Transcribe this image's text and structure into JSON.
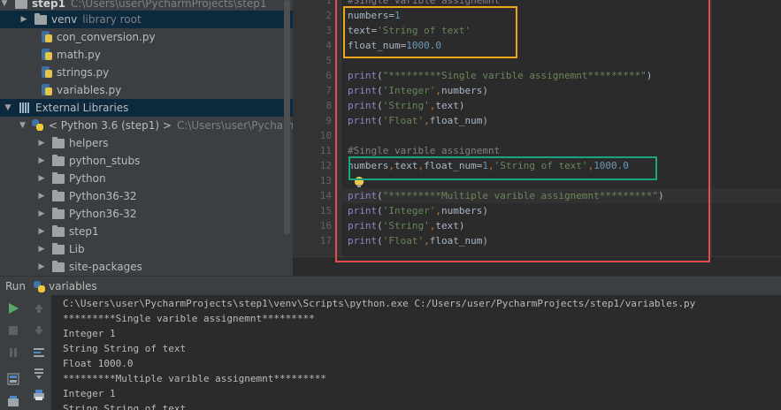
{
  "project_tree": {
    "rows": [
      {
        "label": "step1",
        "muted": "C:\\Users\\user\\PycharmProjects\\step1"
      },
      {
        "label": "venv",
        "muted": "library root"
      },
      {
        "label": "con_conversion.py"
      },
      {
        "label": "math.py"
      },
      {
        "label": "strings.py"
      },
      {
        "label": "variables.py"
      },
      {
        "label": "External Libraries"
      },
      {
        "label": "< Python 3.6 (step1) >",
        "muted": "C:\\Users\\user\\PycharmProjects"
      },
      {
        "label": "helpers"
      },
      {
        "label": "python_stubs"
      },
      {
        "label": "Python"
      },
      {
        "label": "Python36-32"
      },
      {
        "label": "Python36-32"
      },
      {
        "label": "step1"
      },
      {
        "label": "Lib"
      },
      {
        "label": "site-packages"
      }
    ]
  },
  "editor": {
    "line_numbers": [
      "1",
      "2",
      "3",
      "4",
      "5",
      "6",
      "7",
      "8",
      "9",
      "10",
      "11",
      "12",
      "13",
      "14",
      "15",
      "16",
      "17"
    ],
    "lines": {
      "l1": "#Single varible assignemnt",
      "l2_var": "numbers",
      "l2_op": "=",
      "l2_val": "1",
      "l3_var": "text",
      "l3_op": "=",
      "l3_val": "'String of text'",
      "l4_var": "float_num",
      "l4_op": "=",
      "l4_val": "1000.0",
      "l6_fn": "print",
      "l6_rest_open": "(",
      "l6_str": "\"*********Single varible assignemnt*********\"",
      "l6_close": ")",
      "l7_fn": "print",
      "l7_open": "(",
      "l7_str": "'Integer'",
      "l7_comma": ",",
      "l7_arg": "numbers",
      "l7_close": ")",
      "l8_fn": "print",
      "l8_open": "(",
      "l8_str": "'String'",
      "l8_comma": ",",
      "l8_arg": "text",
      "l8_close": ")",
      "l9_fn": "print",
      "l9_open": "(",
      "l9_str": "'Float'",
      "l9_comma": ",",
      "l9_arg": "float_num",
      "l9_close": ")",
      "l11": "#Single varible assignemnt",
      "l12_a": "numbers",
      "l12_c1": ",",
      "l12_b": "text",
      "l12_c2": ",",
      "l12_c": "float_num",
      "l12_eq": "=",
      "l12_v1": "1",
      "l12_c3": ",",
      "l12_v2": "'String of text'",
      "l12_c4": ",",
      "l12_v3": "1000.0",
      "l14_fn": "print",
      "l14_open": "(",
      "l14_str": "\"*********Multiple varible assignemnt*********\"",
      "l14_close": ")",
      "l15_fn": "print",
      "l15_open": "(",
      "l15_str": "'Integer'",
      "l15_comma": ",",
      "l15_arg": "numbers",
      "l15_close": ")",
      "l16_fn": "print",
      "l16_open": "(",
      "l16_str": "'String'",
      "l16_comma": ",",
      "l16_arg": "text",
      "l16_close": ")",
      "l17_fn": "print",
      "l17_open": "(",
      "l17_str": "'Float'",
      "l17_comma": ",",
      "l17_arg": "float_num",
      "l17_close": ")"
    }
  },
  "run_panel": {
    "label": "Run",
    "tab": "variables",
    "output": [
      "C:\\Users\\user\\PycharmProjects\\step1\\venv\\Scripts\\python.exe C:/Users/user/PycharmProjects/step1/variables.py",
      "*********Single varible assignemnt*********",
      "Integer 1",
      "String String of text",
      "Float 1000.0",
      "*********Multiple varible assignemnt*********",
      "Integer 1",
      "String String of text"
    ]
  },
  "colors": {
    "annotation_red": "#e54d4d",
    "annotation_orange": "#f2a51b",
    "annotation_teal": "#19a57f",
    "run_green": "#59a869"
  },
  "icons": [
    "folder-icon",
    "python-file-icon",
    "libraries-icon",
    "python-sdk-icon",
    "run-icon",
    "stop-icon",
    "pause-icon",
    "lightbulb-icon"
  ]
}
